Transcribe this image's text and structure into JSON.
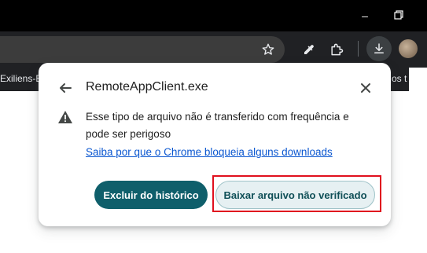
{
  "bookmarks_bar": {
    "item_left": "Exiliens-B",
    "item_right": "os t"
  },
  "download_bubble": {
    "title": "RemoteAppClient.exe",
    "warning_text": "Esse tipo de arquivo não é transferido com frequência e pode ser perigoso",
    "learn_more_link": "Saiba por que o Chrome bloqueia alguns downloads",
    "primary_button": "Excluir do histórico",
    "secondary_button": "Baixar arquivo não verificado"
  },
  "icons": {
    "back": "arrow-left-icon",
    "close": "close-icon",
    "warning": "warning-icon",
    "star": "star-icon",
    "eyedropper": "eyedropper-icon",
    "extensions": "puzzle-icon",
    "download": "download-icon",
    "minimize": "minimize-icon",
    "restore": "restore-icon"
  },
  "colors": {
    "primary_button_bg": "#0f5f6b",
    "secondary_button_bg": "#e6f0f2",
    "link": "#0b57d0",
    "highlight_border": "#e0101e"
  }
}
